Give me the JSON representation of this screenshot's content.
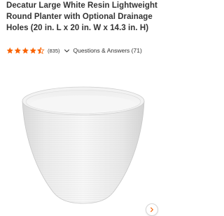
{
  "product": {
    "title": "Decatur Large White Resin Lightweight Round Planter with Optional Drainage Holes (20 in. L x 20 in. W x 14.3 in. H)"
  },
  "rating": {
    "stars": 4.5,
    "max_stars": 5,
    "count_label": "(835)",
    "star_color": "#f96302"
  },
  "qa": {
    "label": "Questions & Answers (71)"
  },
  "gallery": {
    "image_icon": "white-round-planter",
    "next_icon": "chevron-right-icon",
    "accent_color": "#f96302"
  }
}
